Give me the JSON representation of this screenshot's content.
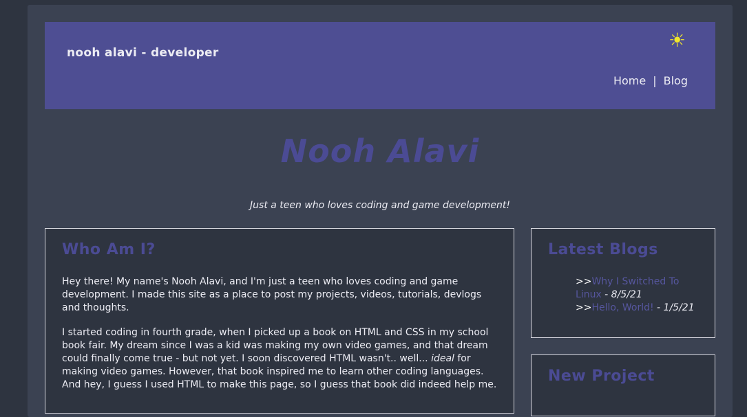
{
  "header": {
    "site_title": "nooh alavi - developer",
    "theme_toggle_glyph": "☀",
    "nav": [
      {
        "label": "Home"
      },
      {
        "label": "Blog"
      }
    ],
    "nav_separator": "|"
  },
  "hero": {
    "name": "Nooh Alavi",
    "tagline": "Just a teen who loves coding and game development!"
  },
  "about": {
    "heading": "Who Am I?",
    "paragraph1": "Hey there! My name's Nooh Alavi, and I'm just a teen who loves coding and game development. I made this site as a place to post my projects, videos, tutorials, devlogs and thoughts.",
    "paragraph2_before": "I started coding in fourth grade, when I picked up a book on HTML and CSS in my school book fair. My dream since I was a kid was making my own video games, and that dream could finally come true - but not yet. I soon discovered HTML wasn't.. well... ",
    "paragraph2_em": "ideal",
    "paragraph2_after": " for making video games. However, that book inspired me to learn other coding languages. And hey, I guess I used HTML to make this page, so I guess that book did indeed help me."
  },
  "latest_blogs": {
    "heading": "Latest Blogs",
    "prefix": ">>",
    "items": [
      {
        "title": "Why I Switched To Linux",
        "date": " - 8/5/21"
      },
      {
        "title": "Hello, World!",
        "date": " - 1/5/21"
      }
    ]
  },
  "new_project": {
    "heading": "New Project"
  },
  "colors": {
    "background": "#2e3440",
    "panel": "#3b4252",
    "accent": "#4e4e93",
    "sun": "#f1e62c"
  }
}
